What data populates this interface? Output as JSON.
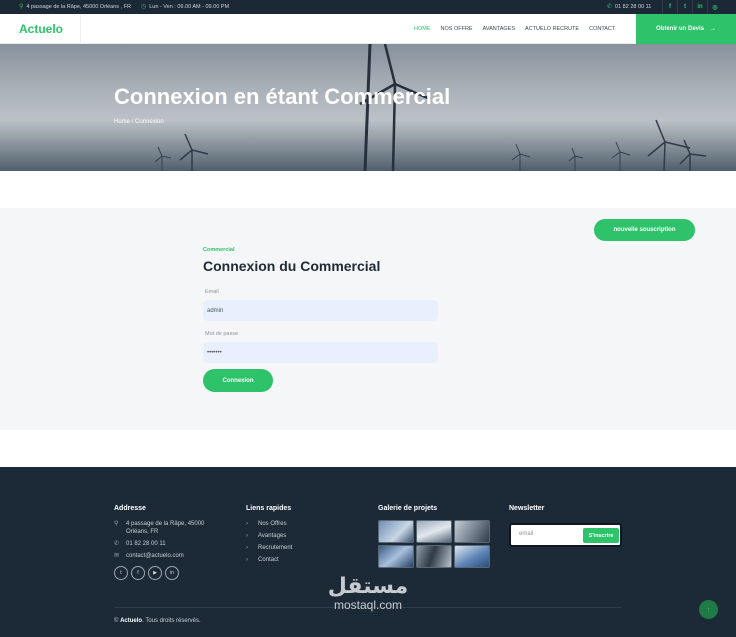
{
  "topbar": {
    "address": "4 passage de la Râpe, 45000 Orléans , FR",
    "hours": "Lun - Ven : 09.00 AM - 09.00 PM",
    "phone": "01 82 28 00 11",
    "social_icons": [
      "facebook-icon",
      "twitter-icon",
      "linkedin-icon",
      "instagram-icon"
    ]
  },
  "navbar": {
    "brand": "Actuelo",
    "menu": [
      "HOME",
      "NOS OFFRE",
      "AVANTAGES",
      "ACTUELO RECRUTE",
      "CONTACT"
    ],
    "active_item": "HOME",
    "cta_label": "Obtenir un Devis",
    "cta_arrow": "→"
  },
  "hero": {
    "title": "Connexion en étant Commercial",
    "breadcrumb_home": "Home",
    "breadcrumb_sep": "/",
    "breadcrumb_current": "Connexion"
  },
  "login": {
    "signup_button": "nouvelle souscription",
    "kicker": "Commercial",
    "title": "Connexion du Commercial",
    "email_label": "Email",
    "email_value": "admin",
    "password_label": "Mot de passe",
    "password_value": "•••••••",
    "submit_label": "Connexion"
  },
  "footer": {
    "address_heading": "Addresse",
    "address_line1": "4 passage de la Râpe, 45000",
    "address_line2": "Orléans, FR",
    "phone": "01 82 28 00 11",
    "email": "contact@actuelo.com",
    "social_icons": [
      "twitter-icon",
      "facebook-icon",
      "youtube-icon",
      "linkedin-icon"
    ],
    "links_heading": "Liens rapides",
    "links": [
      "Nos Offres",
      "Avantages",
      "Recrutement",
      "Contact"
    ],
    "gallery_heading": "Galerie de projets",
    "newsletter_heading": "Newsletter",
    "newsletter_placeholder": "email",
    "newsletter_button": "S'inscrire",
    "copyright_symbol": "©",
    "copyright_brand": "Actuelo",
    "copyright_text": ". Tous droits réservés."
  },
  "watermark": {
    "arabic": "مستقل",
    "latin": "mostaql.com"
  },
  "colors": {
    "accent": "#2ec36a",
    "dark": "#1b2835",
    "footer": "#1c2a38",
    "input_bg": "#e8f0fe"
  }
}
